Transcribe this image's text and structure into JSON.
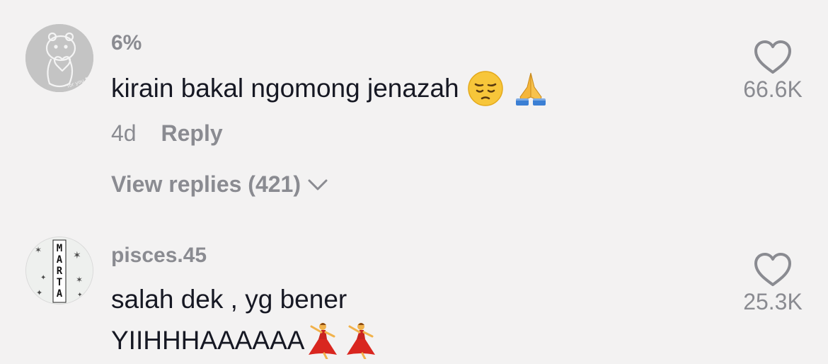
{
  "comments": [
    {
      "username": "6%",
      "text": "kirain bakal ngomong jenazah",
      "emojis": [
        "pensive-face",
        "folded-hands"
      ],
      "time": "4d",
      "reply_label": "Reply",
      "view_replies_label": "View replies (421)",
      "likes": "66.6K"
    },
    {
      "username": "pisces.45",
      "text_line1": "salah dek , yg bener",
      "text_line2": "YIIHHHAAAAAA",
      "emojis": [
        "dancer-woman",
        "dancer-woman"
      ],
      "avatar_text": "MARTA",
      "likes": "25.3K"
    }
  ],
  "colors": {
    "background": "#f3f2f2",
    "primary_text": "#161823",
    "secondary_text": "#8a8b91"
  }
}
